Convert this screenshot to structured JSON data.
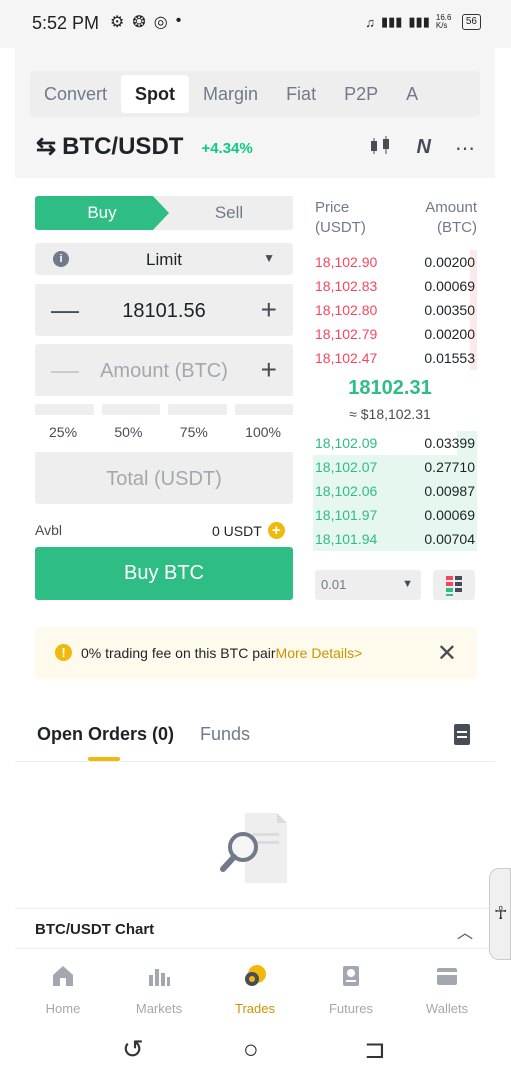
{
  "status_bar": {
    "time": "5:52 PM",
    "net_speed": "16.6 K/s",
    "battery": "56"
  },
  "tabs": [
    {
      "label": "Convert"
    },
    {
      "label": "Spot"
    },
    {
      "label": "Margin"
    },
    {
      "label": "Fiat"
    },
    {
      "label": "P2P"
    },
    {
      "label": "A"
    }
  ],
  "pair": {
    "name": "BTC/USDT",
    "change": "+4.34%"
  },
  "order_form": {
    "buy_label": "Buy",
    "sell_label": "Sell",
    "order_type": "Limit",
    "price_value": "18101.56",
    "amount_placeholder": "Amount (BTC)",
    "percents": [
      "25%",
      "50%",
      "75%",
      "100%"
    ],
    "total_placeholder": "Total (USDT)",
    "avbl_label": "Avbl",
    "avbl_value": "0 USDT",
    "buy_button": "Buy BTC"
  },
  "order_book": {
    "price_header": "Price",
    "price_unit": "(USDT)",
    "amount_header": "Amount",
    "amount_unit": "(BTC)",
    "asks": [
      {
        "price": "18,102.90",
        "amount": "0.00200",
        "depth": 0.04
      },
      {
        "price": "18,102.83",
        "amount": "0.00069",
        "depth": 0.04
      },
      {
        "price": "18,102.80",
        "amount": "0.00350",
        "depth": 0.04
      },
      {
        "price": "18,102.79",
        "amount": "0.00200",
        "depth": 0.04
      },
      {
        "price": "18,102.47",
        "amount": "0.01553",
        "depth": 0.04
      }
    ],
    "mid_price": "18102.31",
    "mid_usd": "≈ $18,102.31",
    "bids": [
      {
        "price": "18,102.09",
        "amount": "0.03399",
        "depth": 0.12
      },
      {
        "price": "18,102.07",
        "amount": "0.27710",
        "depth": 1.0
      },
      {
        "price": "18,102.06",
        "amount": "0.00987",
        "depth": 1.0
      },
      {
        "price": "18,101.97",
        "amount": "0.00069",
        "depth": 1.0
      },
      {
        "price": "18,101.94",
        "amount": "0.00704",
        "depth": 1.0
      }
    ],
    "depth_value": "0.01"
  },
  "notice": {
    "text": "0% trading fee on this BTC pair",
    "link": "More Details>"
  },
  "orders_tabs": {
    "open_orders": "Open Orders (0)",
    "funds": "Funds"
  },
  "chart_section": {
    "title": "BTC/USDT Chart"
  },
  "bottom_nav": [
    {
      "label": "Home",
      "icon": "home-icon"
    },
    {
      "label": "Markets",
      "icon": "markets-icon"
    },
    {
      "label": "Trades",
      "icon": "trades-icon",
      "active": true
    },
    {
      "label": "Futures",
      "icon": "futures-icon"
    },
    {
      "label": "Wallets",
      "icon": "wallets-icon"
    }
  ],
  "colors": {
    "buy_green": "#2ebd85",
    "sell_red": "#f6465d",
    "accent_yellow": "#f0b90b"
  }
}
